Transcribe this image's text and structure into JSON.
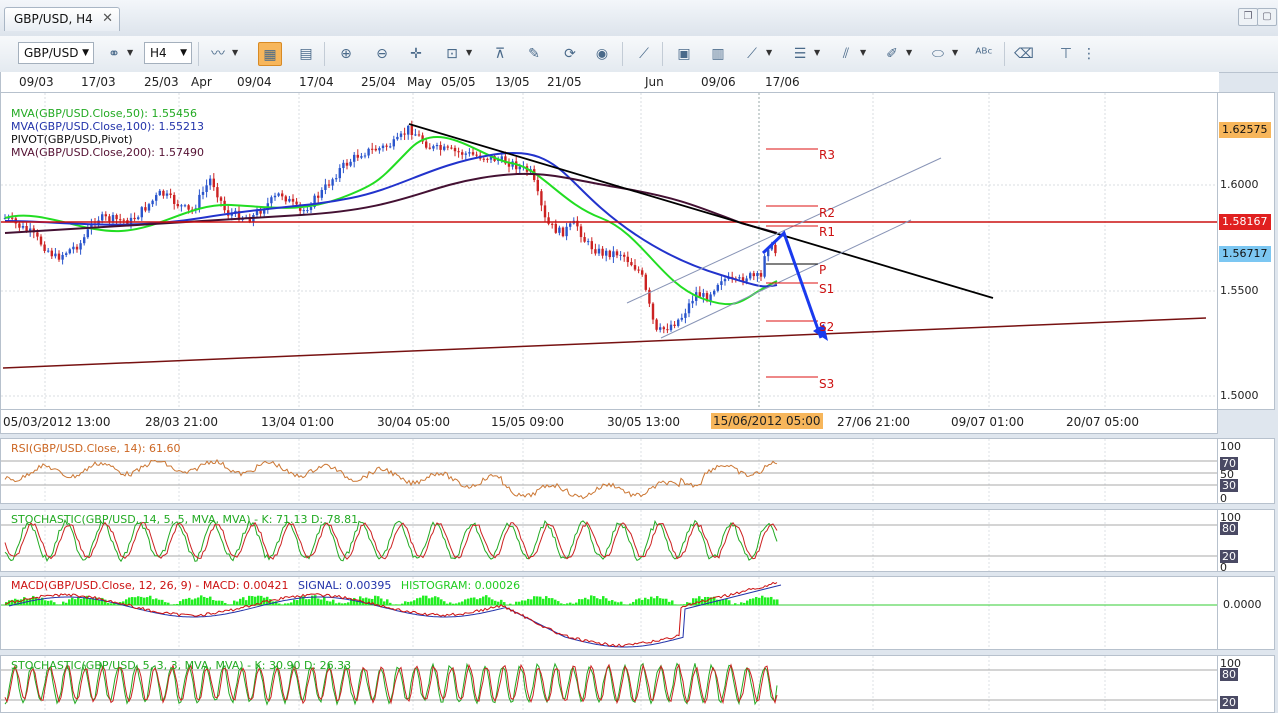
{
  "tab": {
    "title": "GBP/USD, H4"
  },
  "toolbar": {
    "symbol": "GBP/USD",
    "timeframe": "H4"
  },
  "top_axis": [
    "09/03",
    "17/03",
    "25/03",
    "Apr",
    "09/04",
    "17/04",
    "25/04",
    "May",
    "05/05",
    "13/05",
    "21/05",
    "Jun",
    "09/06",
    "17/06"
  ],
  "legend": [
    {
      "text": "MVA(GBP/USD.Close,50): 1.55456",
      "color": "#22aa22"
    },
    {
      "text": "MVA(GBP/USD.Close,100): 1.55213",
      "color": "#2233aa"
    },
    {
      "text": "PIVOT(GBP/USD,Pivot)",
      "color": "#111111"
    },
    {
      "text": "MVA(GBP/USD.Close,200): 1.57490",
      "color": "#551133"
    }
  ],
  "pivots": {
    "r3": "R3",
    "r2": "R2",
    "r1": "R1",
    "p": "P",
    "s1": "S1",
    "s2": "S2",
    "s3": "S3"
  },
  "price_scale": {
    "ticks": [
      "1.6000",
      "1.5500",
      "1.5000"
    ],
    "marker_top": "1.62575",
    "marker_resistance": "1.58167",
    "marker_last": "1.56717"
  },
  "bottom_axis": {
    "labels": [
      "05/03/2012 13:00",
      "28/03 21:00",
      "13/04 01:00",
      "30/04 05:00",
      "15/05 09:00",
      "30/05 13:00",
      "27/06 21:00",
      "09/07 01:00",
      "20/07 05:00"
    ],
    "highlight": "15/06/2012 05:00"
  },
  "rsi": {
    "label": "RSI(GBP/USD.Close, 14): 61.60",
    "scale": [
      "100",
      "70",
      "50",
      "30",
      "0"
    ]
  },
  "stoch1": {
    "label": "STOCHASTIC(GBP/USD, 14, 5, 5, MVA, MVA) -  K: 71.13   D: 78.81",
    "scale": [
      "100",
      "80",
      "20",
      "0"
    ]
  },
  "macd": {
    "label_main": "MACD(GBP/USD.Close, 12, 26, 9) -  MACD: 0.00421",
    "label_signal": "SIGNAL: 0.00395",
    "label_hist": "HISTOGRAM: 0.00026",
    "scale": "0.0000"
  },
  "stoch2": {
    "label": "STOCHASTIC(GBP/USD, 5, 3, 3, MVA, MVA) -  K: 30.90   D: 26.33",
    "scale": [
      "100",
      "80",
      "20"
    ]
  },
  "colors": {
    "up_candle": "#2a55cc",
    "down_candle": "#cc2222",
    "ma50": "#22dd22",
    "ma100": "#2233cc",
    "ma200": "#441133",
    "resistance": "#cc1111",
    "support": "#771111",
    "accent": "#f7b65b"
  }
}
